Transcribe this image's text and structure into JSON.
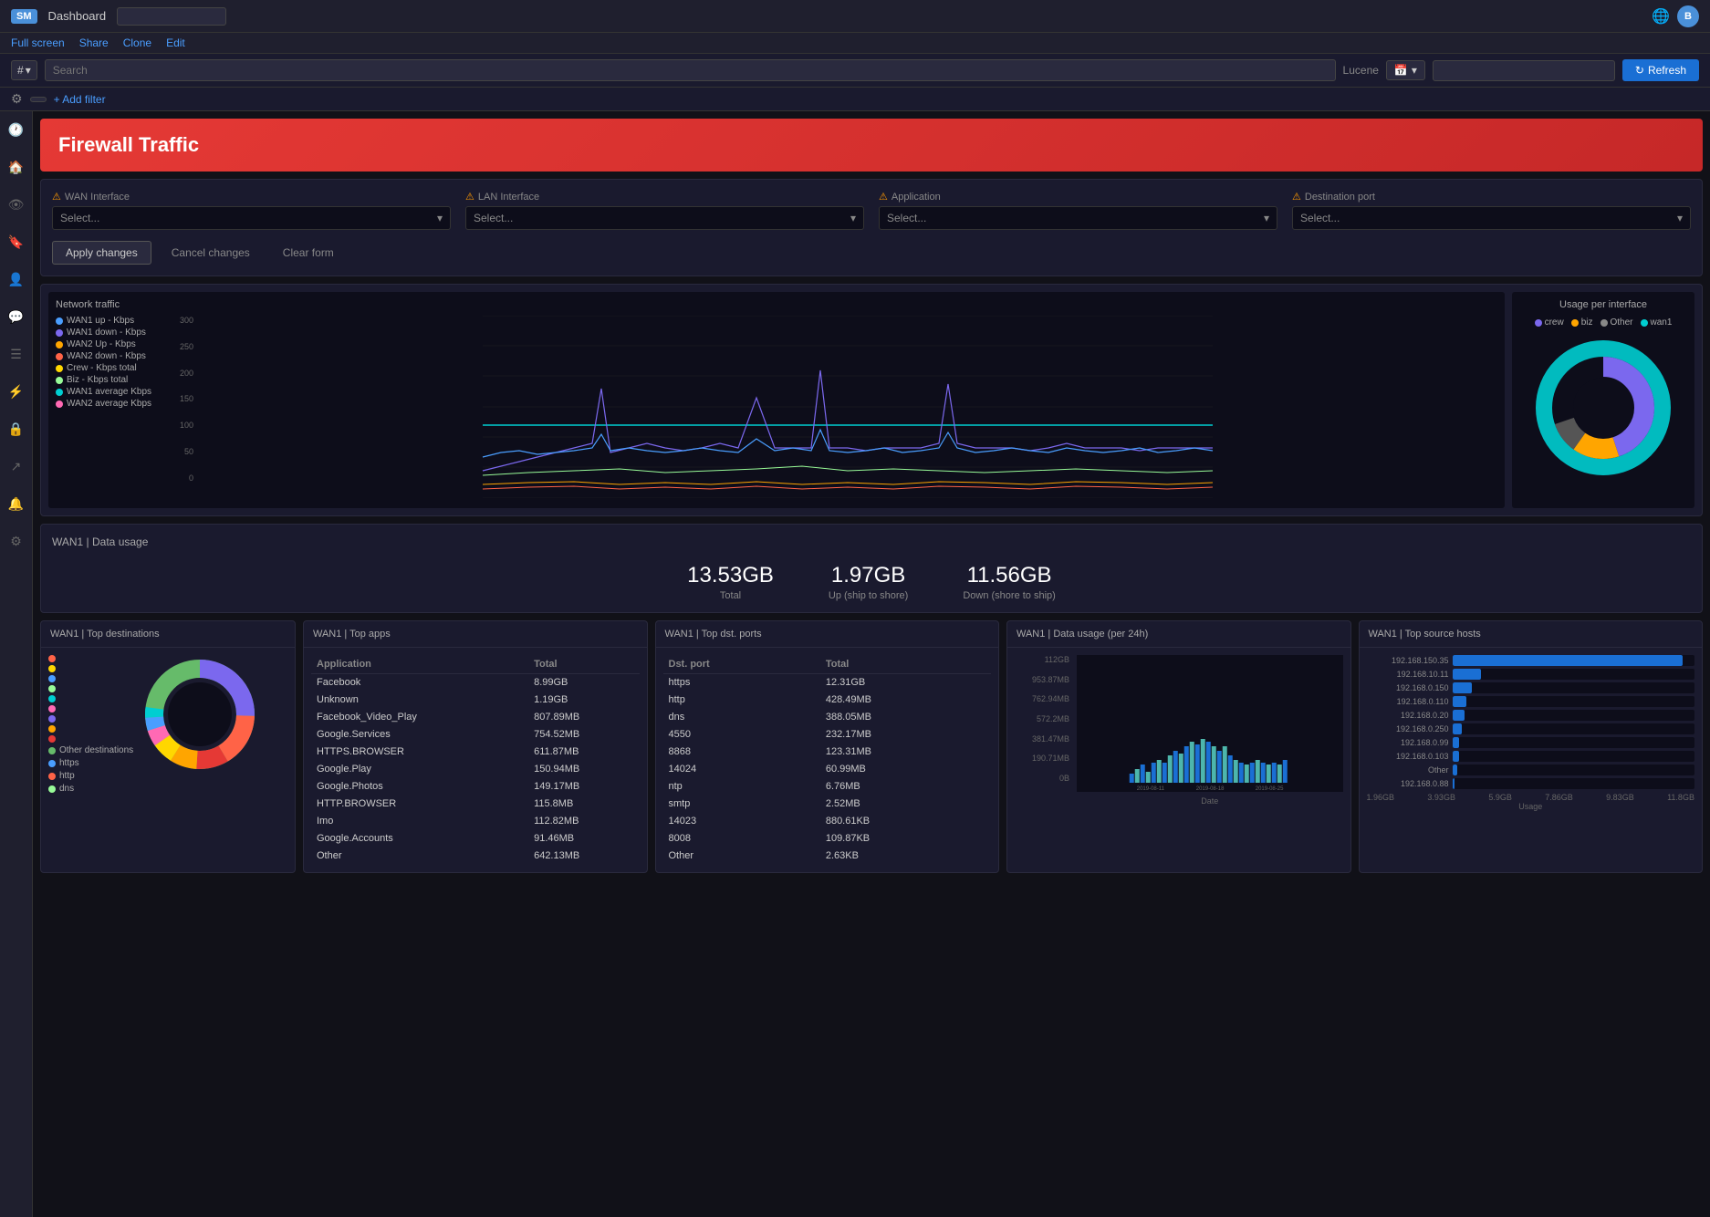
{
  "topbar": {
    "logo": "SM",
    "title": "Dashboard",
    "input_placeholder": "",
    "nav_items": [
      "Full screen",
      "Share",
      "Clone",
      "Edit"
    ],
    "globe_icon": "🌐",
    "avatar": "B"
  },
  "searchbar": {
    "prefix": "#",
    "search_placeholder": "Search",
    "lucene_label": "Lucene",
    "calendar_icon": "📅",
    "refresh_label": "Refresh"
  },
  "filterbar": {
    "add_filter_label": "+ Add filter"
  },
  "sidebar": {
    "icons": [
      "🕐",
      "🏠",
      "👁",
      "🔖",
      "👤",
      "💬",
      "📋",
      "⚡",
      "🔒",
      "↗",
      "🔔",
      "⚙"
    ]
  },
  "firewall": {
    "title": "Firewall Traffic"
  },
  "filters": {
    "wan_label": "WAN Interface",
    "lan_label": "LAN Interface",
    "app_label": "Application",
    "dst_label": "Destination port",
    "select_placeholder": "Select...",
    "apply_label": "Apply changes",
    "cancel_label": "Cancel changes",
    "clear_label": "Clear form"
  },
  "network_traffic": {
    "title": "Network traffic",
    "y_labels": [
      "300",
      "250",
      "200",
      "150",
      "100",
      "50",
      "0"
    ],
    "legend": [
      {
        "label": "WAN1 up - Kbps",
        "color": "#4a9eff"
      },
      {
        "label": "WAN1 down - Kbps",
        "color": "#7b68ee"
      },
      {
        "label": "WAN2 Up - Kbps",
        "color": "#ffa500"
      },
      {
        "label": "WAN2 down - Kbps",
        "color": "#ff6347"
      },
      {
        "label": "Crew - Kbps total",
        "color": "#ffd700"
      },
      {
        "label": "Biz - Kbps total",
        "color": "#98fb98"
      },
      {
        "label": "WAN1 average Kbps",
        "color": "#00ced1"
      },
      {
        "label": "WAN2 average Kbps",
        "color": "#ff69b4"
      }
    ]
  },
  "usage_per_interface": {
    "title": "Usage per interface",
    "legend": [
      {
        "label": "crew",
        "color": "#7b68ee"
      },
      {
        "label": "biz",
        "color": "#ffa500"
      },
      {
        "label": "Other",
        "color": "#888"
      },
      {
        "label": "wan1",
        "color": "#00ced1"
      }
    ],
    "segments": [
      {
        "color": "#7b68ee",
        "percent": 45
      },
      {
        "color": "#ffa500",
        "percent": 15
      },
      {
        "color": "#888",
        "percent": 10
      },
      {
        "color": "#00ced1",
        "percent": 30
      }
    ]
  },
  "data_usage": {
    "header": "WAN1 | Data usage",
    "total_value": "13.53GB",
    "total_label": "Total",
    "up_value": "1.97GB",
    "up_label": "Up (ship to shore)",
    "down_value": "11.56GB",
    "down_label": "Down (shore to ship)"
  },
  "top_destinations": {
    "title": "WAN1 | Top destinations",
    "legend": [
      {
        "color": "#ff6347",
        "label": ""
      },
      {
        "color": "#ffd700",
        "label": ""
      },
      {
        "color": "#4a9eff",
        "label": ""
      },
      {
        "color": "#98fb98",
        "label": ""
      },
      {
        "color": "#00ced1",
        "label": ""
      },
      {
        "color": "#ff69b4",
        "label": ""
      },
      {
        "color": "#7b68ee",
        "label": ""
      },
      {
        "color": "#ffa500",
        "label": ""
      },
      {
        "color": "#e53935",
        "label": ""
      },
      {
        "color": "#66bb6a",
        "label": "Other destinations"
      },
      {
        "color": "#4a9eff",
        "label": "https"
      },
      {
        "color": "#ff6347",
        "label": "http"
      },
      {
        "color": "#98fb98",
        "label": "dns"
      }
    ]
  },
  "top_apps": {
    "title": "WAN1 | Top apps",
    "columns": [
      "Application",
      "Total"
    ],
    "rows": [
      {
        "app": "Facebook",
        "total": "8.99GB"
      },
      {
        "app": "Unknown",
        "total": "1.19GB"
      },
      {
        "app": "Facebook_Video_Play",
        "total": "807.89MB"
      },
      {
        "app": "Google.Services",
        "total": "754.52MB"
      },
      {
        "app": "HTTPS.BROWSER",
        "total": "611.87MB"
      },
      {
        "app": "Google.Play",
        "total": "150.94MB"
      },
      {
        "app": "Google.Photos",
        "total": "149.17MB"
      },
      {
        "app": "HTTP.BROWSER",
        "total": "115.8MB"
      },
      {
        "app": "Imo",
        "total": "112.82MB"
      },
      {
        "app": "Google.Accounts",
        "total": "91.46MB"
      },
      {
        "app": "Other",
        "total": "642.13MB"
      }
    ]
  },
  "top_dst_ports": {
    "title": "WAN1 | Top dst. ports",
    "columns": [
      "Dst. port",
      "Total"
    ],
    "rows": [
      {
        "port": "https",
        "total": "12.31GB"
      },
      {
        "port": "http",
        "total": "428.49MB"
      },
      {
        "port": "dns",
        "total": "388.05MB"
      },
      {
        "port": "4550",
        "total": "232.17MB"
      },
      {
        "port": "8868",
        "total": "123.31MB"
      },
      {
        "port": "14024",
        "total": "60.99MB"
      },
      {
        "port": "ntp",
        "total": "6.76MB"
      },
      {
        "port": "smtp",
        "total": "2.52MB"
      },
      {
        "port": "14023",
        "total": "880.61KB"
      },
      {
        "port": "8008",
        "total": "109.87KB"
      },
      {
        "port": "Other",
        "total": "2.63KB"
      }
    ]
  },
  "data_usage_24h": {
    "title": "WAN1 | Data usage (per 24h)",
    "y_labels": [
      "112GB",
      "953.87MB",
      "762.94MB",
      "572.2MB",
      "381.47MB",
      "190.71MB",
      "0B"
    ],
    "x_labels": [
      "2019-08-11",
      "2019-08-18",
      "2019-08-25"
    ],
    "bars": [
      8,
      12,
      15,
      10,
      18,
      22,
      19,
      25,
      30,
      28,
      35,
      40,
      38,
      42,
      35,
      30,
      28,
      32,
      25,
      22,
      18,
      15,
      12,
      10,
      8,
      15,
      20
    ]
  },
  "top_source_hosts": {
    "title": "WAN1 | Top source hosts",
    "hosts": [
      {
        "ip": "192.168.150.35",
        "pct": 95
      },
      {
        "ip": "192.168.10.11",
        "pct": 12
      },
      {
        "ip": "192.168.0.150",
        "pct": 8
      },
      {
        "ip": "192.168.0.110",
        "pct": 6
      },
      {
        "ip": "192.168.0.20",
        "pct": 5
      },
      {
        "ip": "192.168.0.250",
        "pct": 4
      },
      {
        "ip": "192.168.0.99",
        "pct": 3
      },
      {
        "ip": "192.168.0.103",
        "pct": 3
      },
      {
        "ip": "Other",
        "pct": 2
      },
      {
        "ip": "192.168.0.88",
        "pct": 1
      }
    ],
    "x_labels": [
      "1.96GB",
      "3.93GB",
      "5.9GB",
      "7.86GB",
      "9.83GB",
      "11.8GB"
    ]
  }
}
